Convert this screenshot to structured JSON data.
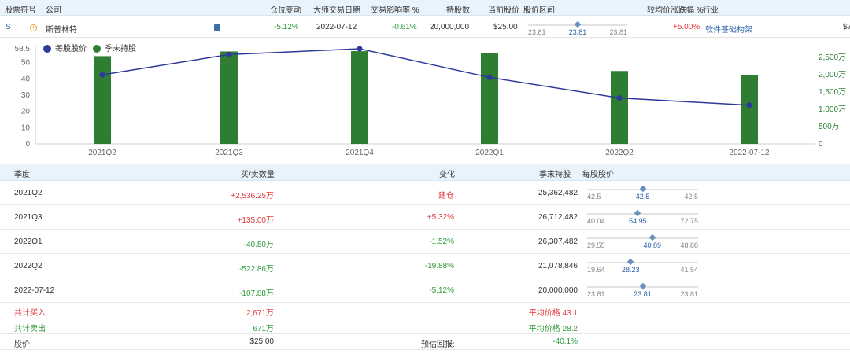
{
  "header": {
    "cols": [
      "股票符号",
      "公司",
      "仓位变动",
      "大师交易日期",
      "交易影响率 %",
      "持股数",
      "当前股价",
      "股价区间",
      "较均价涨跌幅 %",
      "行业"
    ]
  },
  "stock_row": {
    "symbol": "S",
    "company": "斯普林特",
    "position_change": "-5.12%",
    "trade_date": "2022-07-12",
    "impact": "-0.61%",
    "shares": "20,000,000",
    "price": "$25.00",
    "range": {
      "low": "23.81",
      "current": "23.81",
      "high": "23.81",
      "pos": 0.5
    },
    "vs_avg": "+5.00%",
    "industry": "软件基础构架",
    "trailing": "$7"
  },
  "chart_data": {
    "type": "bar",
    "categories": [
      "2021Q2",
      "2021Q3",
      "2021Q4",
      "2022Q1",
      "2022Q2",
      "2022-07-12"
    ],
    "series": [
      {
        "name": "每股股价",
        "type": "line",
        "axis": "left",
        "values": [
          42.5,
          54.95,
          58.5,
          40.89,
          28.23,
          23.81
        ]
      },
      {
        "name": "季末持股",
        "type": "bar",
        "axis": "right",
        "values": [
          25362482,
          26712482,
          26800000,
          26307482,
          21078846,
          20000000
        ]
      }
    ],
    "left_ticks": [
      "0",
      "10",
      "20",
      "30",
      "40",
      "50",
      "58.5"
    ],
    "right_ticks": [
      "0",
      "500万",
      "1,000万",
      "1,500万",
      "2,000万",
      "2,500万"
    ],
    "left_lim": [
      0,
      58.5
    ],
    "right_lim": [
      0,
      27500000
    ],
    "colors": {
      "bar": "#2e7d32",
      "line": "#2d3a9a"
    },
    "legend": "top-left"
  },
  "table": {
    "headers": [
      "季度",
      "买/卖数量",
      "变化",
      "季末持股",
      "每股股价"
    ],
    "rows": [
      {
        "q": "2021Q2",
        "qty": "+2,536.25万",
        "qty_cls": "red",
        "chg": "建仓",
        "chg_cls": "red",
        "hold": "25,362,482",
        "lo": "42.5",
        "cur": "42.5",
        "hi": "42.5",
        "pos": 0.5
      },
      {
        "q": "2021Q3",
        "qty": "+135.00万",
        "qty_cls": "red",
        "chg": "+5.32%",
        "chg_cls": "red",
        "hold": "26,712,482",
        "lo": "40.04",
        "cur": "54.95",
        "hi": "72.75",
        "pos": 0.456
      },
      {
        "q": "2022Q1",
        "qty": "-40.50万",
        "qty_cls": "green",
        "chg": "-1.52%",
        "chg_cls": "green",
        "hold": "26,307,482",
        "lo": "29.55",
        "cur": "40.89",
        "hi": "48.88",
        "pos": 0.587
      },
      {
        "q": "2022Q2",
        "qty": "-522.86万",
        "qty_cls": "green",
        "chg": "-19.88%",
        "chg_cls": "green",
        "hold": "21,078,846",
        "lo": "19.64",
        "cur": "28.23",
        "hi": "41.54",
        "pos": 0.392
      },
      {
        "q": "2022-07-12",
        "qty": "-107.88万",
        "qty_cls": "green",
        "chg": "-5.12%",
        "chg_cls": "green",
        "hold": "20,000,000",
        "lo": "23.81",
        "cur": "23.81",
        "hi": "23.81",
        "pos": 0.5
      }
    ],
    "summary": {
      "buy_label": "共计买入",
      "buy_val": "2,671万",
      "buy_avg": "平均价格 43.1",
      "sell_label": "共计卖出",
      "sell_val": "671万",
      "sell_avg": "平均价格 28.2",
      "price_label": "股价:",
      "price_val": "$25.00",
      "est_label": "预估回报:",
      "est_val": "-40.1%"
    }
  }
}
